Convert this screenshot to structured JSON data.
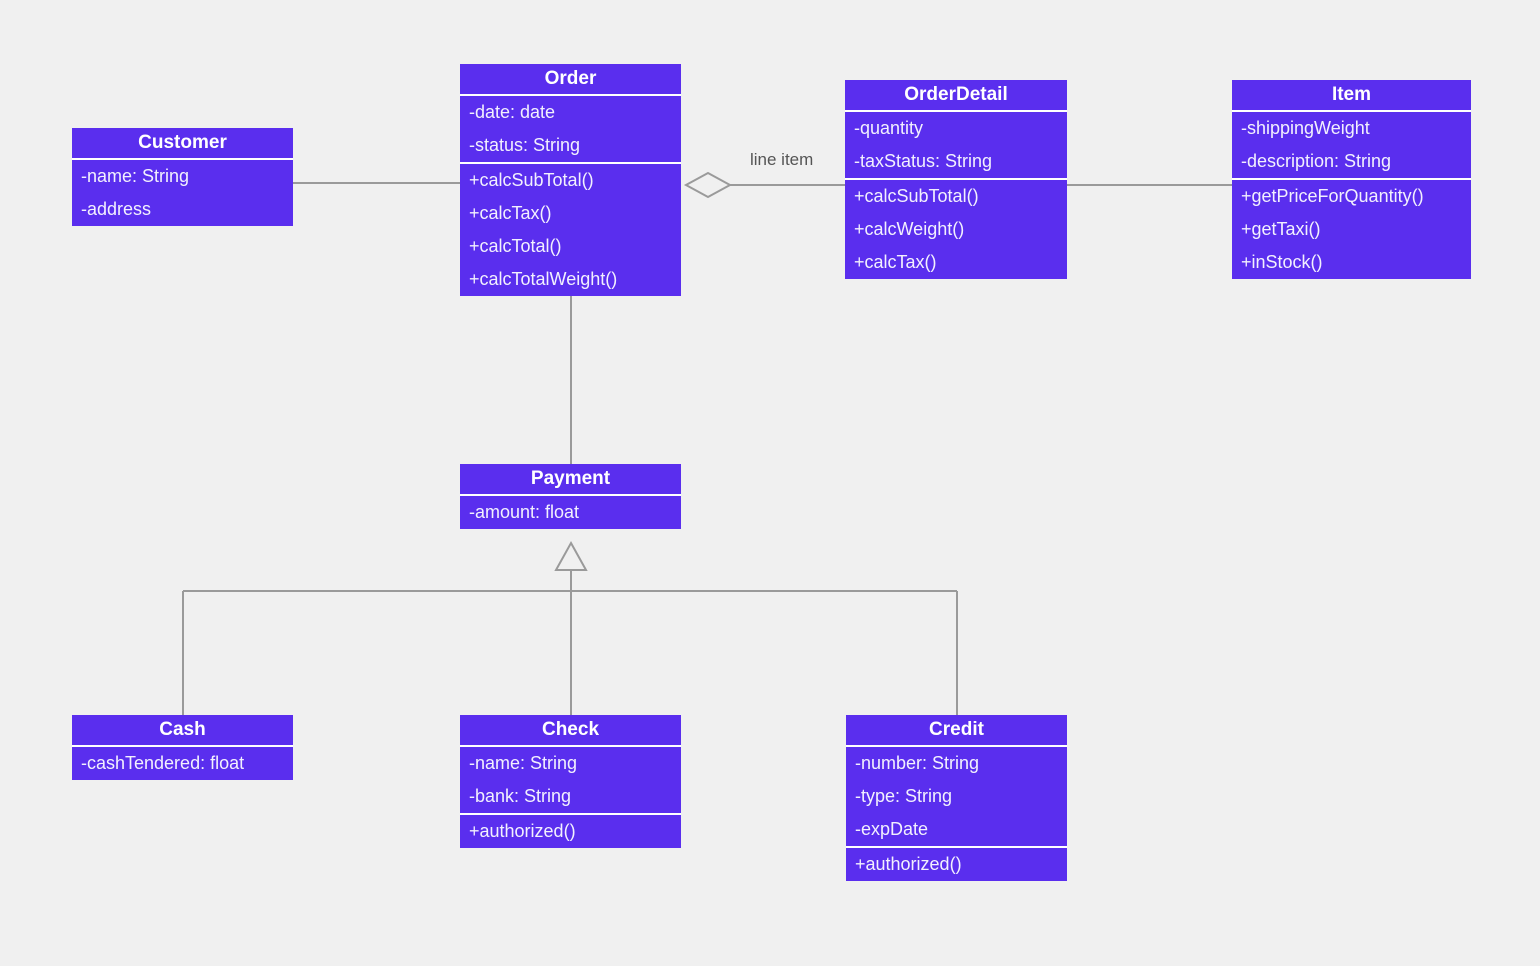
{
  "diagram": {
    "type": "uml-class-diagram",
    "background_color": "#f0f0f0",
    "class_fill_color": "#5A2EEE",
    "class_text_color": "#ffffff",
    "edge_color": "#9a9a9a"
  },
  "classes": {
    "customer": {
      "name": "Customer",
      "attributes": [
        "-name: String",
        "-address"
      ],
      "operations": []
    },
    "order": {
      "name": "Order",
      "attributes": [
        "-date: date",
        "-status: String"
      ],
      "operations": [
        "+calcSubTotal()",
        "+calcTax()",
        "+calcTotal()",
        "+calcTotalWeight()"
      ]
    },
    "orderdetail": {
      "name": "OrderDetail",
      "attributes": [
        "-quantity",
        "-taxStatus: String"
      ],
      "operations": [
        "+calcSubTotal()",
        "+calcWeight()",
        "+calcTax()"
      ]
    },
    "item": {
      "name": "Item",
      "attributes": [
        "-shippingWeight",
        "-description: String"
      ],
      "operations": [
        "+getPriceForQuantity()",
        "+getTaxi()",
        "+inStock()"
      ]
    },
    "payment": {
      "name": "Payment",
      "attributes": [
        "-amount: float"
      ],
      "operations": []
    },
    "cash": {
      "name": "Cash",
      "attributes": [
        "-cashTendered: float"
      ],
      "operations": []
    },
    "check": {
      "name": "Check",
      "attributes": [
        "-name: String",
        "-bank: String"
      ],
      "operations": [
        "+authorized()"
      ]
    },
    "credit": {
      "name": "Credit",
      "attributes": [
        "-number: String",
        "-type: String",
        "-expDate"
      ],
      "operations": [
        "+authorized()"
      ]
    }
  },
  "edges": {
    "line_item_label": "line item"
  }
}
